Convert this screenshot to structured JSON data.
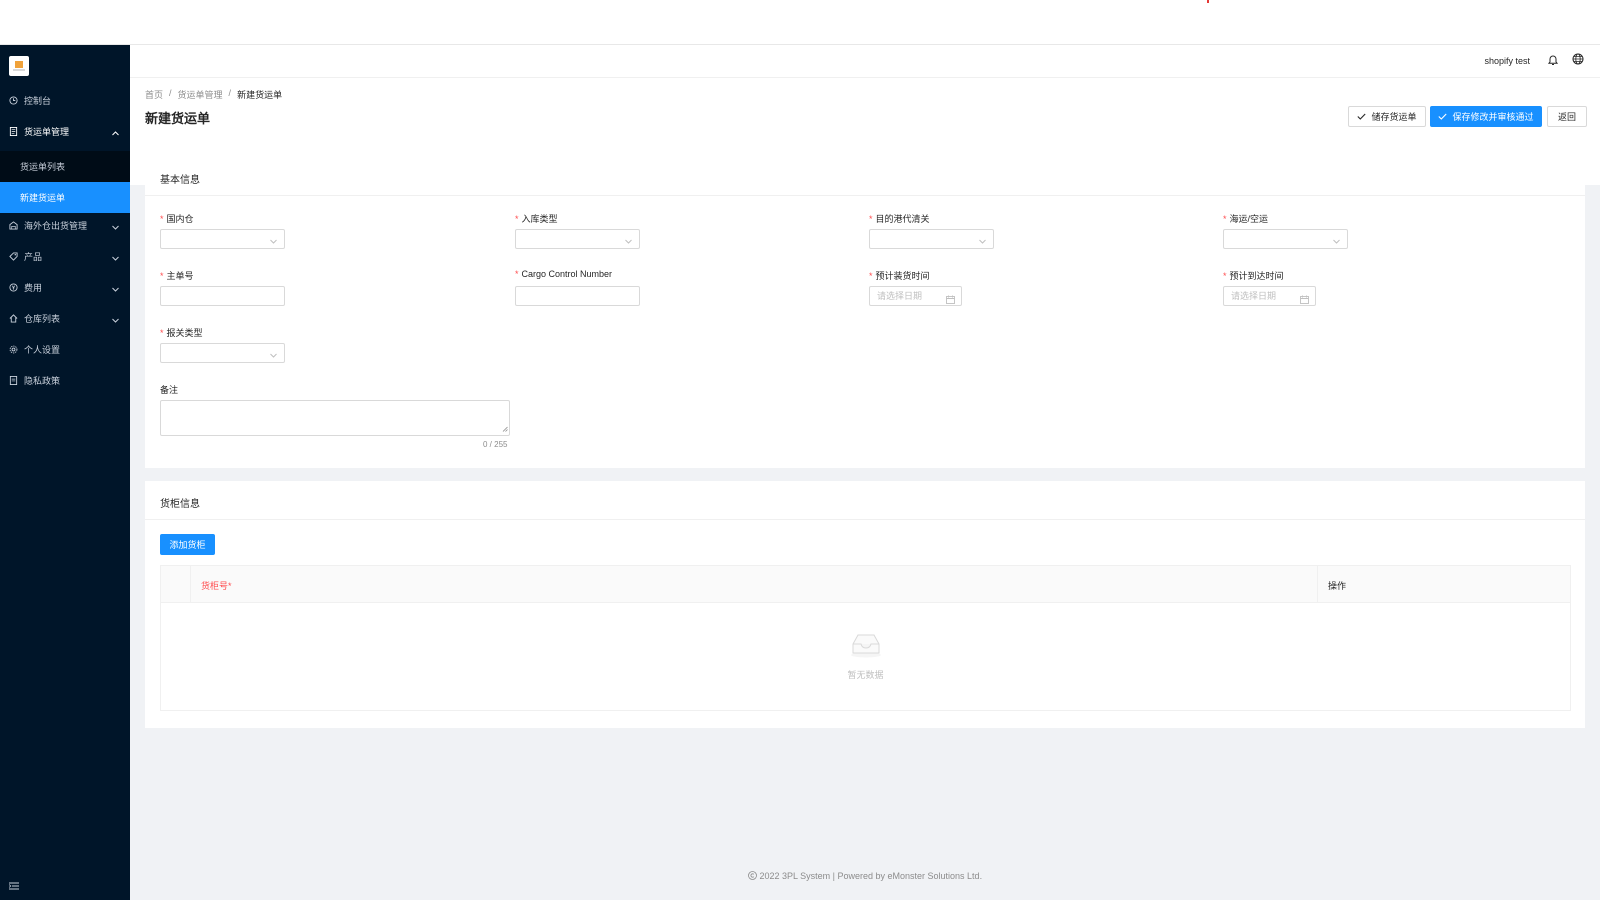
{
  "header": {
    "user_name": "shopify test"
  },
  "sidebar": {
    "items": [
      {
        "label": "控制台",
        "icon": "clock-icon"
      },
      {
        "label": "货运单管理",
        "icon": "file-icon",
        "expanded": true
      },
      {
        "label": "海外仓出货管理",
        "icon": "warehouse-icon"
      },
      {
        "label": "产品",
        "icon": "tag-icon"
      },
      {
        "label": "费用",
        "icon": "yen-icon"
      },
      {
        "label": "仓库列表",
        "icon": "home-icon"
      },
      {
        "label": "个人设置",
        "icon": "gear-icon"
      },
      {
        "label": "隐私政策",
        "icon": "document-icon"
      }
    ],
    "sub_items": [
      {
        "label": "货运单列表"
      },
      {
        "label": "新建货运单",
        "active": true
      }
    ]
  },
  "breadcrumb": [
    "首页",
    "货运单管理",
    "新建货运单"
  ],
  "breadcrumb_sep": "/",
  "page": {
    "title": "新建货运单",
    "buttons": {
      "save": "储存货运单",
      "save_approve": "保存修改并审核通过",
      "back": "返回"
    }
  },
  "basic_info": {
    "title": "基本信息",
    "fields": {
      "domestic_warehouse": {
        "label": "国内仓",
        "required": true
      },
      "inbound_type": {
        "label": "入库类型",
        "required": true
      },
      "destination_clearance": {
        "label": "目的港代清关",
        "required": true
      },
      "sea_air": {
        "label": "海运/空运",
        "required": true
      },
      "master_no": {
        "label": "主单号",
        "required": true
      },
      "cargo_control": {
        "label": "Cargo Control Number",
        "required": true
      },
      "est_loading": {
        "label": "预计装货时间",
        "required": true,
        "placeholder": "请选择日期"
      },
      "est_arrival": {
        "label": "预计到达时间",
        "required": true,
        "placeholder": "请选择日期"
      },
      "customs_type": {
        "label": "报关类型",
        "required": true
      },
      "remark": {
        "label": "备注",
        "counter": "0 / 255"
      }
    }
  },
  "container_info": {
    "title": "货柜信息",
    "add_button": "添加货柜",
    "columns": [
      "货柜号*",
      "操作"
    ],
    "empty_text": "暂无数据"
  },
  "footer": {
    "text": "2022 3PL System | Powered by eMonster Solutions Ltd."
  },
  "colors": {
    "sidebar_bg": "#001529",
    "primary": "#1890ff",
    "required": "#ff4d4f"
  }
}
